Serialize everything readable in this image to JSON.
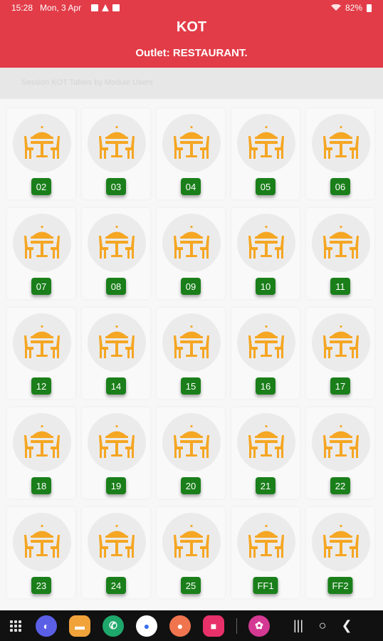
{
  "status_bar": {
    "time": "15:28",
    "date": "Mon, 3 Apr",
    "battery": "82%"
  },
  "header": {
    "title": "KOT",
    "outlet": "Outlet: RESTAURANT."
  },
  "subheader": {
    "text": "Session KOT Tables by Module Users"
  },
  "tables": [
    "02",
    "03",
    "04",
    "05",
    "06",
    "07",
    "08",
    "09",
    "10",
    "11",
    "12",
    "14",
    "15",
    "16",
    "17",
    "18",
    "19",
    "20",
    "21",
    "22",
    "23",
    "24",
    "25",
    "FF1",
    "FF2"
  ],
  "colors": {
    "header": "#e23c48",
    "badge": "#1a7f1a",
    "icon": "#f5a623"
  },
  "nav_bar": {
    "apps": [
      {
        "icon": "samsung-internet-icon",
        "color": "#5b5fe6"
      },
      {
        "icon": "my-files-icon",
        "color": "#f1a33a"
      },
      {
        "icon": "phone-icon",
        "color": "#1fa86b"
      },
      {
        "icon": "messages-icon",
        "color": "#ffffff"
      },
      {
        "icon": "contacts-icon",
        "color": "#f0754f"
      },
      {
        "icon": "screen-recorder-icon",
        "color": "#e8316a"
      },
      {
        "icon": "bixby-icon",
        "color": "#d43a93"
      }
    ],
    "system": [
      "recents-icon",
      "home-icon",
      "back-icon"
    ]
  }
}
